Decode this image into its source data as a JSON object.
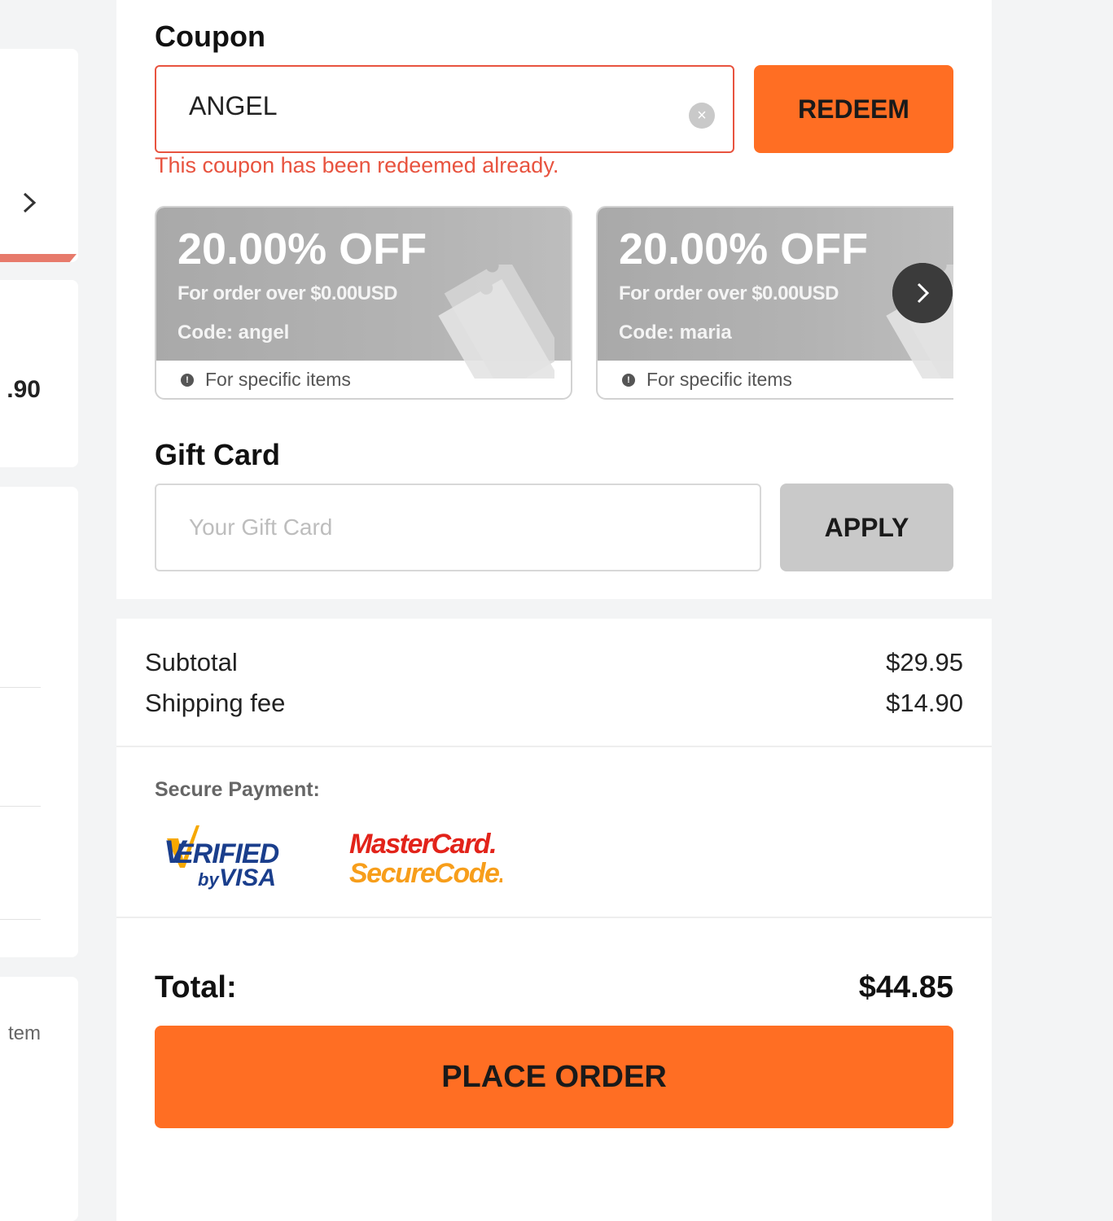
{
  "left_column": {
    "amount_fragment": ".90",
    "item_fragment": "tem"
  },
  "coupon": {
    "title": "Coupon",
    "input_value": "ANGEL",
    "redeem_label": "REDEEM",
    "error_message": "This coupon has been redeemed already.",
    "cards": [
      {
        "discount": "20.00% OFF",
        "condition": "For order over $0.00USD",
        "code": "Code: angel",
        "scope": "For specific items"
      },
      {
        "discount": "20.00% OFF",
        "condition": "For order over $0.00USD",
        "code": "Code: maria",
        "scope": "For specific items"
      }
    ]
  },
  "gift_card": {
    "title": "Gift Card",
    "placeholder": "Your Gift Card",
    "apply_label": "APPLY"
  },
  "summary": {
    "subtotal_label": "Subtotal",
    "subtotal_value": "$29.95",
    "shipping_label": "Shipping fee",
    "shipping_value": "$14.90"
  },
  "payment": {
    "secure_label": "Secure Payment:",
    "logos": [
      "Verified by Visa",
      "MasterCard SecureCode"
    ]
  },
  "total": {
    "label": "Total:",
    "value": "$44.85",
    "place_order_label": "PLACE ORDER"
  },
  "colors": {
    "accent": "#ff6e23",
    "error": "#e8533f",
    "disabled_button": "#c9c9c9",
    "coupon_card": "#b0b0b0"
  },
  "icons": [
    "chevron-right-icon",
    "clear-icon",
    "info-icon",
    "ticket-icon",
    "next-arrow-icon"
  ]
}
